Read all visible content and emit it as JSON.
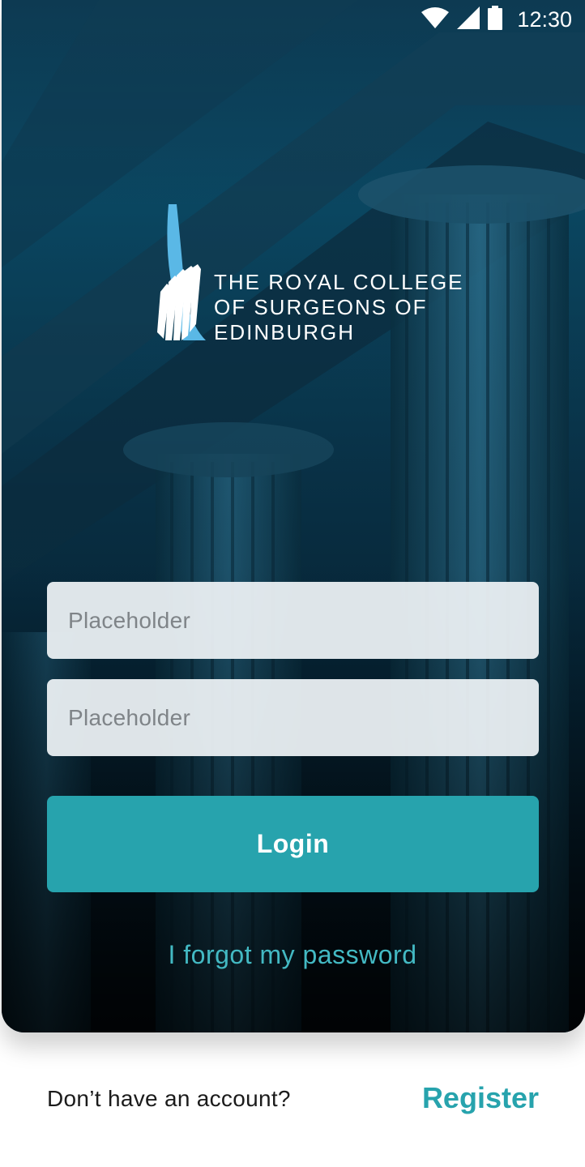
{
  "status_bar": {
    "time": "12:30",
    "icons": [
      "wifi-icon",
      "cell-signal-icon",
      "battery-icon"
    ]
  },
  "logo": {
    "lines": [
      "THE ROYAL COLLEGE",
      "OF SURGEONS OF",
      "EDINBURGH"
    ]
  },
  "form": {
    "field1_placeholder": "Placeholder",
    "field2_placeholder": "Placeholder",
    "login_label": "Login",
    "forgot_label": "I forgot my password"
  },
  "footer": {
    "question": "Don’t have an account?",
    "register_label": "Register"
  },
  "colors": {
    "accent": "#27a3ad",
    "link": "#43b9c3",
    "logo_blue": "#5ab8e6"
  }
}
